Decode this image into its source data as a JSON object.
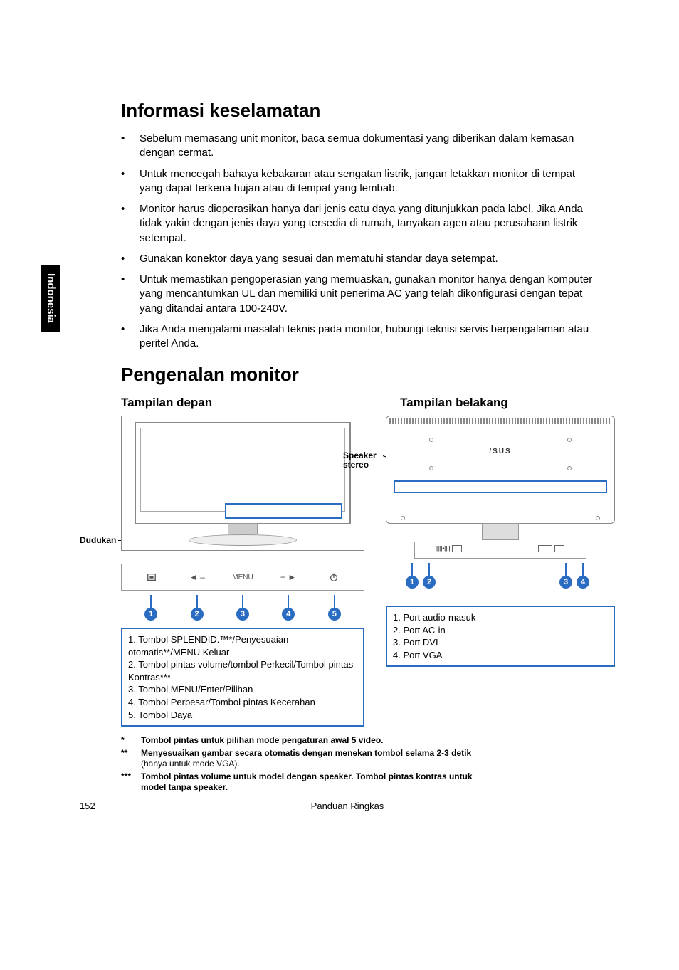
{
  "side_tab": "Indonesia",
  "sections": {
    "safety_title": "Informasi keselamatan",
    "intro_title": "Pengenalan monitor",
    "bullets": [
      "Sebelum memasang unit monitor, baca semua dokumentasi yang diberikan dalam kemasan dengan cermat.",
      "Untuk mencegah bahaya kebakaran atau sengatan listrik, jangan letakkan monitor di tempat yang dapat terkena hujan atau di tempat yang lembab.",
      "Monitor harus dioperasikan hanya dari jenis catu daya yang ditunjukkan pada label. Jika Anda tidak yakin dengan jenis daya yang tersedia di rumah, tanyakan agen atau perusahaan listrik setempat.",
      "Gunakan konektor daya yang sesuai dan mematuhi standar daya setempat.",
      "Untuk memastikan pengoperasian yang memuaskan, gunakan monitor hanya dengan komputer yang mencantumkan UL dan memiliki unit penerima AC yang telah dikonfigurasi dengan tepat yang ditandai antara 100-240V.",
      "Jika Anda mengalami masalah teknis pada monitor, hubungi teknisi servis berpengalaman atau peritel Anda."
    ]
  },
  "front": {
    "heading": "Tampilan depan",
    "stand_label": "Dudukan",
    "controls": {
      "c1": "S",
      "c2": "◄ –",
      "c3": "MENU",
      "c4": "+ ►",
      "c5": "⏻"
    },
    "nums": [
      "1",
      "2",
      "3",
      "4",
      "5"
    ],
    "legend": [
      "1. Tombol SPLENDID.™*/Penyesuaian otomatis**/MENU Keluar",
      "2. Tombol pintas volume/tombol Perkecil/Tombol pintas Kontras***",
      "3. Tombol MENU/Enter/Pilihan",
      "4. Tombol Perbesar/Tombol pintas Kecerahan",
      "5. Tombol Daya"
    ]
  },
  "rear": {
    "heading": "Tampilan belakang",
    "speaker_label": "Speaker stereo",
    "nums": [
      "1",
      "2",
      "3",
      "4"
    ],
    "legend": [
      "1. Port audio-masuk",
      "2. Port AC-in",
      "3. Port DVI",
      "4. Port VGA"
    ]
  },
  "footnotes": {
    "f1_mark": "*",
    "f1_bold": "Tombol pintas untuk pilihan mode pengaturan awal 5 video.",
    "f2_mark": "**",
    "f2_bold": "Menyesuaikan gambar secara otomatis dengan menekan tombol selama 2-3 detik",
    "f2_plain": " (hanya untuk mode VGA).",
    "f3_mark": "***",
    "f3_bold": "Tombol pintas volume untuk model dengan speaker. Tombol pintas kontras untuk model tanpa speaker."
  },
  "footer": {
    "page_number": "152",
    "footer_text": "Panduan Ringkas"
  }
}
